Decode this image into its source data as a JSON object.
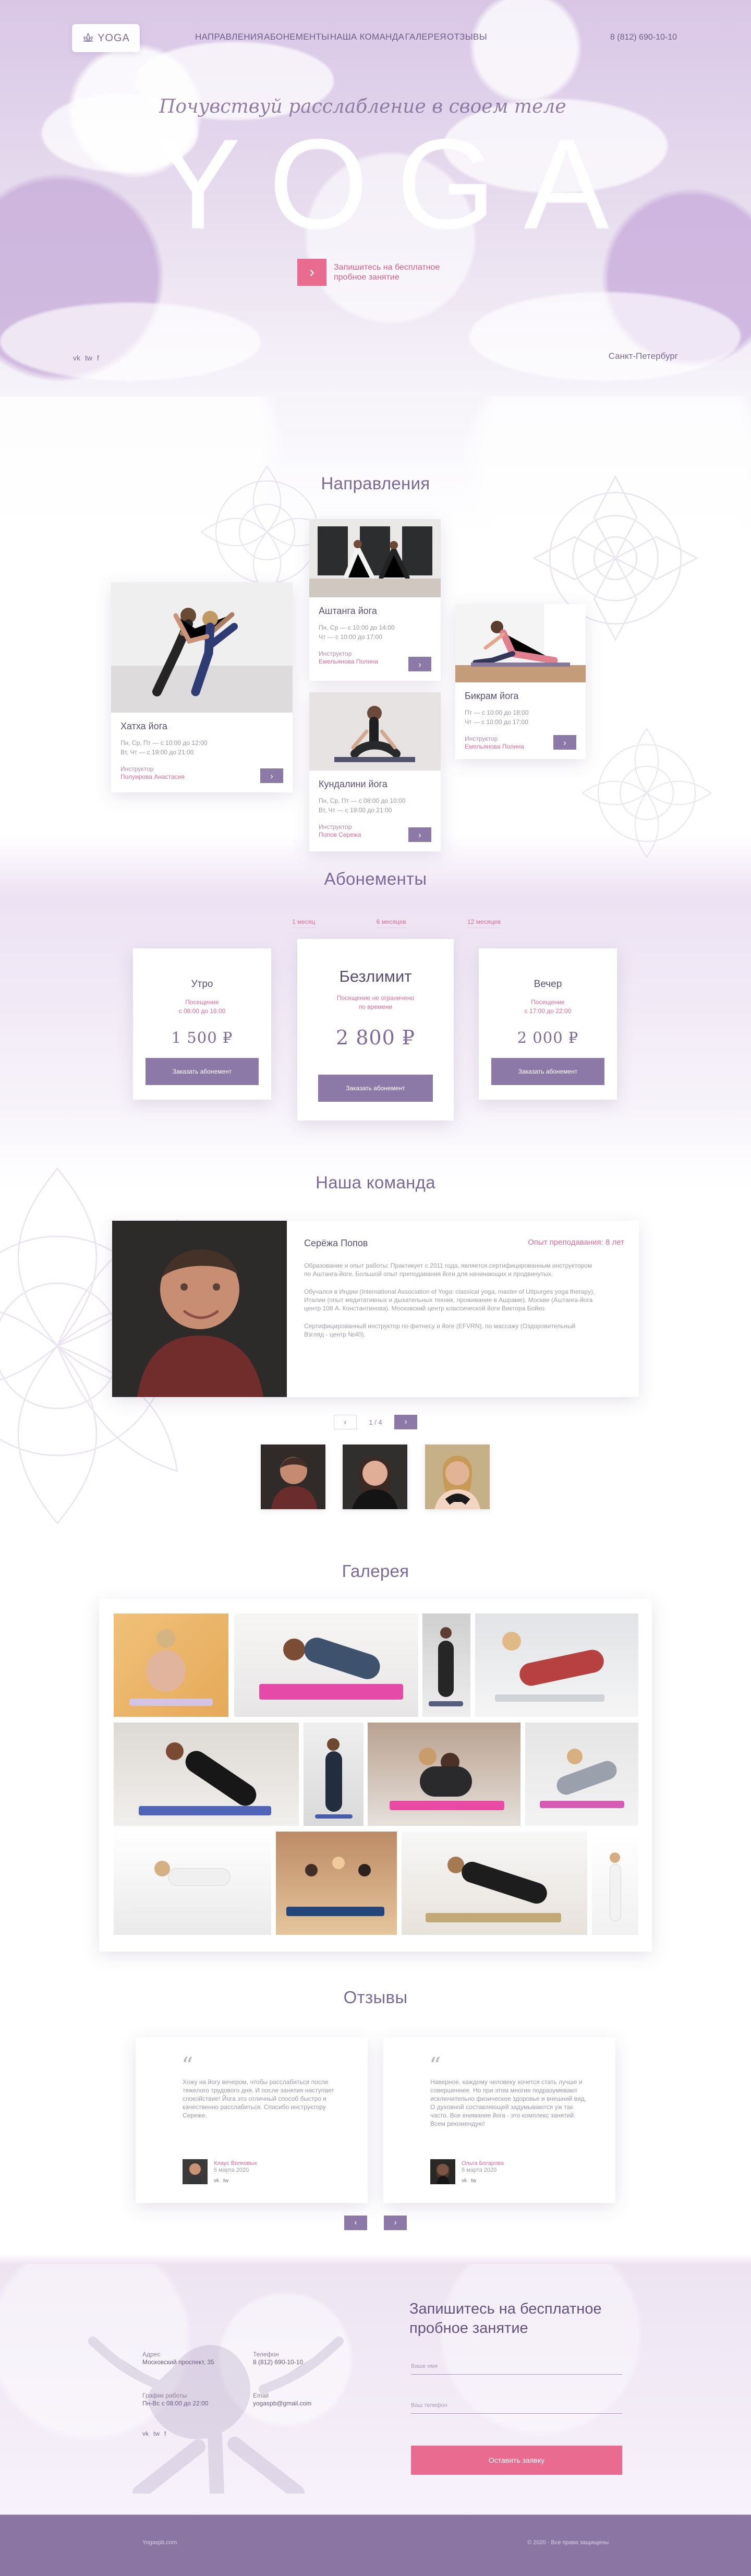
{
  "header": {
    "logo_text": "YOGA",
    "nav": [
      "Направления",
      "Абонементы",
      "Наша команда",
      "Галерея",
      "Отзывы"
    ],
    "phone": "8 (812) 690-10-10"
  },
  "hero": {
    "tagline": "Почувствуй расслабление в своем теле",
    "title": "YOGA",
    "cta_text": "Запишитесь на бесплатное пробное занятие",
    "city": "Санкт-Петербург",
    "social": [
      "vk",
      "tw",
      "f"
    ]
  },
  "directions": {
    "title": "Направления",
    "cards": [
      {
        "title": "Хатха йога",
        "schedule": [
          "Пн, Ср, Пт — с 10:00 до 12:00",
          "Вт, Чт — с 19:00 до 21:00"
        ],
        "instructor_label": "Инструктор",
        "instructor": "Полуирова Анастасия"
      },
      {
        "title": "Аштанга йога",
        "schedule": [
          "Пн, Ср — с 10:00 до 14:00",
          "Чт — с 10:00 до 17:00"
        ],
        "instructor_label": "Инструктор",
        "instructor": "Емельянова Полина"
      },
      {
        "title": "Бикрам йога",
        "schedule": [
          "Пт — с 10:00 до 18:00",
          "Чт — с 10:00 до 17:00"
        ],
        "instructor_label": "Инструктор",
        "instructor": "Емельянова Полина"
      },
      {
        "title": "Кундалини йога",
        "schedule": [
          "Пн, Ср, Пт — с 08:00 до 10:00",
          "Вт, Чт — с 19:00 до 21:00"
        ],
        "instructor_label": "Инструктор",
        "instructor": "Попов Сережа"
      }
    ]
  },
  "memberships": {
    "title": "Абонементы",
    "tabs": [
      "1 месяц",
      "6 месяцев",
      "12 месяцев"
    ],
    "cards": [
      {
        "title": "Утро",
        "details": [
          "Посещение",
          "с 08:00 до 16:00"
        ],
        "price": "1 500 ₽",
        "button": "Заказать абонемент"
      },
      {
        "title": "Безлимит",
        "details": [
          "Посещение не ограничено",
          "по времени"
        ],
        "price": "2 800 ₽",
        "button": "Заказать абонемент"
      },
      {
        "title": "Вечер",
        "details": [
          "Посещение",
          "с 17:00 до 22:00"
        ],
        "price": "2 000 ₽",
        "button": "Заказать абонемент"
      }
    ]
  },
  "team": {
    "title": "Наша команда",
    "name": "Серёжа Попов",
    "experience": "Опыт преподавания: 8 лет",
    "bio": [
      "Образование и опыт работы: Практикует с 2011 года, является сертифицированным инструктором по Аштанга-йоге. Большой опыт преподавания йоги для начинающих и продвинутых.",
      "Обучался в Индии (International Association of Yoga: classical yoga, master of Uttpurges yoga therapy), Италии (опыт медитативных и дыхательных техник, проживание в Ашраме). Москве (Аштанга-йога центр 108 А. Константинова). Московский центр классической йоги Виктора Бойко.",
      "Сертифицированный инструктор по фитнесу и йоге (EFVRN), по массажу (Оздоровительный Взгляд - центр №40)."
    ],
    "pager": "1 / 4"
  },
  "gallery": {
    "title": "Галерея"
  },
  "reviews": {
    "title": "Отзывы",
    "items": [
      {
        "text": "Хожу на йогу вечером, чтобы расслабиться после тяжелого трудового дня. И после занятия наступает спокойствие! Йога это отличный способ быстро и качественно расслабиться. Спасибо инструктору Сереже.",
        "author": "Клаус Волковых",
        "date": "5 марта 2020"
      },
      {
        "text": "Наверное, каждому человеку хочется стать лучше и совершеннее. Но при этом многие подразумевают исключительно физическое здоровье и внешний вид. О духовной составляющей задумываются уж так часто. Все внимание йога - это комплекс занятий. Всем рекомендую!",
        "author": "Ольга Богарова",
        "date": "5 марта 2020"
      }
    ]
  },
  "contact": {
    "address_label": "Адрес",
    "address": "Московский проспект, 35",
    "phone_label": "Телефон",
    "phone": "8 (812) 690-10-10",
    "hours_label": "График работы",
    "hours": "Пн-Вс с 08:00 до 22:00",
    "email_label": "Email",
    "email": "yogaspb@gmail.com",
    "form_title": "Запишитесь на бесплатное пробное занятие",
    "name_placeholder": "Ваше имя",
    "phone_placeholder": "Ваш телефон",
    "submit": "Оставить заявку",
    "social": [
      "vk",
      "tw",
      "f"
    ]
  },
  "footer": {
    "left": "Yogaspb.com",
    "right": "© 2020 · Все права защищены"
  },
  "colors": {
    "accent_pink": "#e96b8f",
    "purple": "#8c79a7",
    "text_purple": "#7b6a97"
  }
}
